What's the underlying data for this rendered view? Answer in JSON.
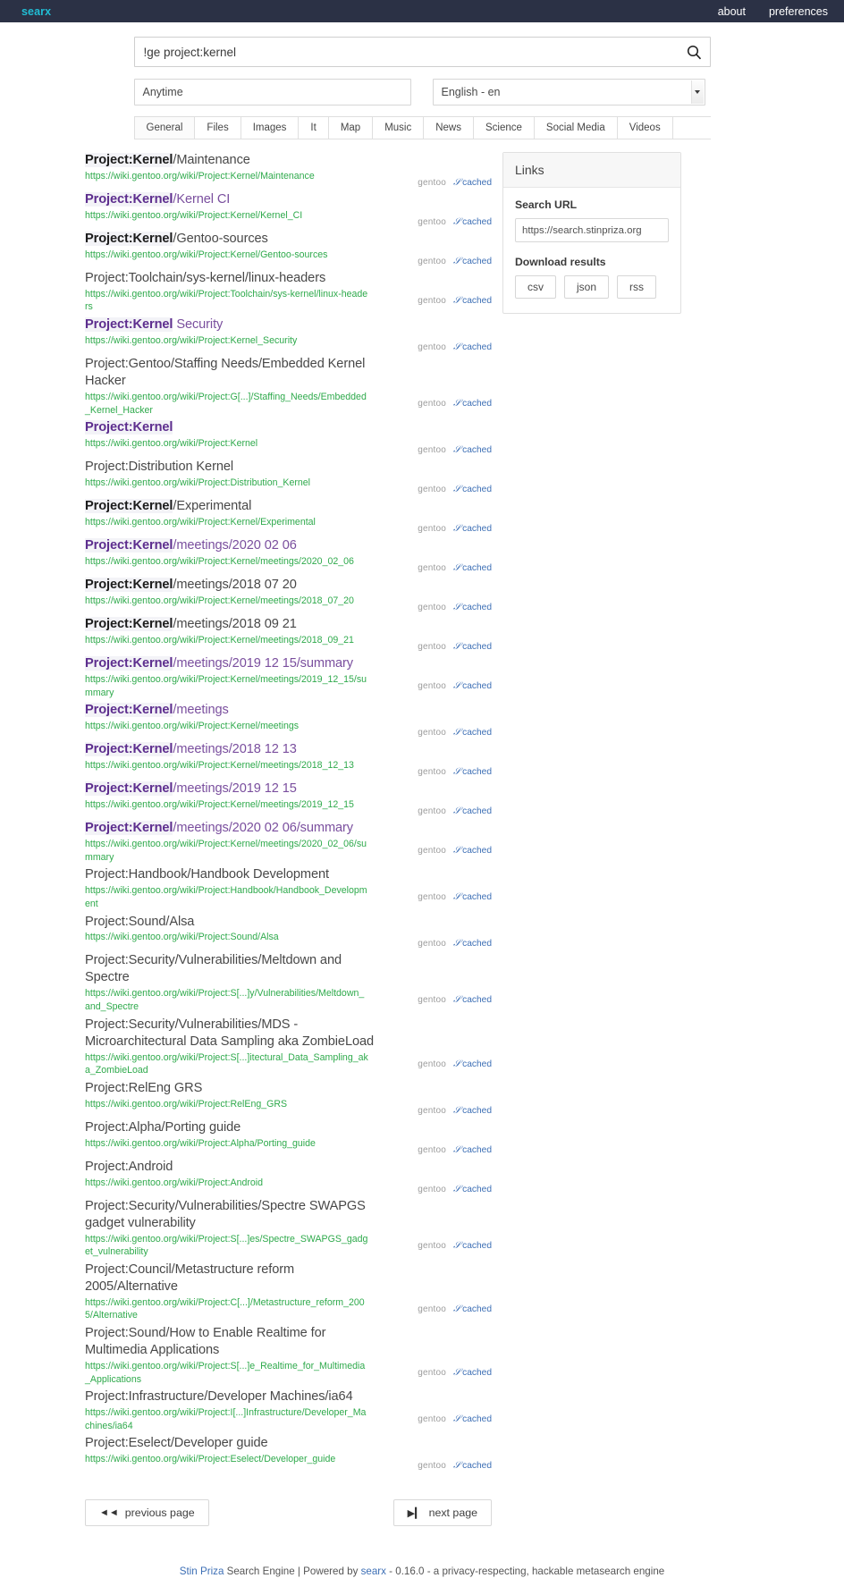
{
  "navbar": {
    "brand": "searx",
    "links": [
      {
        "label": "about"
      },
      {
        "label": "preferences"
      }
    ]
  },
  "search": {
    "query": "!ge project:kernel",
    "placeholder": "",
    "time_range": "Anytime",
    "language": "English - en",
    "search_icon": "search-icon"
  },
  "categories": [
    {
      "label": "General",
      "active": true
    },
    {
      "label": "Files",
      "active": false
    },
    {
      "label": "Images",
      "active": false
    },
    {
      "label": "It",
      "active": false
    },
    {
      "label": "Map",
      "active": false
    },
    {
      "label": "Music",
      "active": false
    },
    {
      "label": "News",
      "active": false
    },
    {
      "label": "Science",
      "active": false
    },
    {
      "label": "Social Media",
      "active": false
    },
    {
      "label": "Videos",
      "active": false
    }
  ],
  "results_meta": {
    "engine_label": "gentoo",
    "cached_label": "cached"
  },
  "results": [
    {
      "title_bold": "Project:Kernel",
      "title_rest": "/Maintenance",
      "visited": false,
      "url": "https://wiki.gentoo.org/wiki/Project:Kernel/Maintenance",
      "engine": "gentoo",
      "cached": "cached"
    },
    {
      "title_bold": "Project:Kernel",
      "title_rest": "/Kernel CI",
      "visited": true,
      "url": "https://wiki.gentoo.org/wiki/Project:Kernel/Kernel_CI",
      "engine": "gentoo",
      "cached": "cached"
    },
    {
      "title_bold": "Project:Kernel",
      "title_rest": "/Gentoo-sources",
      "visited": false,
      "url": "https://wiki.gentoo.org/wiki/Project:Kernel/Gentoo-sources",
      "engine": "gentoo",
      "cached": "cached"
    },
    {
      "title_bold": "",
      "title_rest": "Project:Toolchain/sys-kernel/linux-headers",
      "visited": false,
      "url": "https://wiki.gentoo.org/wiki/Project:Toolchain/sys-kernel/linux-headers",
      "engine": "gentoo",
      "cached": "cached"
    },
    {
      "title_bold": "Project:Kernel",
      "title_rest": " Security",
      "visited": true,
      "url": "https://wiki.gentoo.org/wiki/Project:Kernel_Security",
      "engine": "gentoo",
      "cached": "cached"
    },
    {
      "title_bold": "",
      "title_rest": "Project:Gentoo/Staffing Needs/Embedded Kernel Hacker",
      "visited": false,
      "url": "https://wiki.gentoo.org/wiki/Project:G[...]/Staffing_Needs/Embedded_Kernel_Hacker",
      "engine": "gentoo",
      "cached": "cached"
    },
    {
      "title_bold": "Project:Kernel",
      "title_rest": "",
      "visited": true,
      "url": "https://wiki.gentoo.org/wiki/Project:Kernel",
      "engine": "gentoo",
      "cached": "cached"
    },
    {
      "title_bold": "",
      "title_rest": "Project:Distribution Kernel",
      "visited": false,
      "url": "https://wiki.gentoo.org/wiki/Project:Distribution_Kernel",
      "engine": "gentoo",
      "cached": "cached"
    },
    {
      "title_bold": "Project:Kernel",
      "title_rest": "/Experimental",
      "visited": false,
      "url": "https://wiki.gentoo.org/wiki/Project:Kernel/Experimental",
      "engine": "gentoo",
      "cached": "cached"
    },
    {
      "title_bold": "Project:Kernel",
      "title_rest": "/meetings/2020 02 06",
      "visited": true,
      "url": "https://wiki.gentoo.org/wiki/Project:Kernel/meetings/2020_02_06",
      "engine": "gentoo",
      "cached": "cached"
    },
    {
      "title_bold": "Project:Kernel",
      "title_rest": "/meetings/2018 07 20",
      "visited": false,
      "url": "https://wiki.gentoo.org/wiki/Project:Kernel/meetings/2018_07_20",
      "engine": "gentoo",
      "cached": "cached"
    },
    {
      "title_bold": "Project:Kernel",
      "title_rest": "/meetings/2018 09 21",
      "visited": false,
      "url": "https://wiki.gentoo.org/wiki/Project:Kernel/meetings/2018_09_21",
      "engine": "gentoo",
      "cached": "cached"
    },
    {
      "title_bold": "Project:Kernel",
      "title_rest": "/meetings/2019 12 15/summary",
      "visited": true,
      "url": "https://wiki.gentoo.org/wiki/Project:Kernel/meetings/2019_12_15/summary",
      "engine": "gentoo",
      "cached": "cached"
    },
    {
      "title_bold": "Project:Kernel",
      "title_rest": "/meetings",
      "visited": true,
      "url": "https://wiki.gentoo.org/wiki/Project:Kernel/meetings",
      "engine": "gentoo",
      "cached": "cached"
    },
    {
      "title_bold": "Project:Kernel",
      "title_rest": "/meetings/2018 12 13",
      "visited": true,
      "url": "https://wiki.gentoo.org/wiki/Project:Kernel/meetings/2018_12_13",
      "engine": "gentoo",
      "cached": "cached"
    },
    {
      "title_bold": "Project:Kernel",
      "title_rest": "/meetings/2019 12 15",
      "visited": true,
      "url": "https://wiki.gentoo.org/wiki/Project:Kernel/meetings/2019_12_15",
      "engine": "gentoo",
      "cached": "cached"
    },
    {
      "title_bold": "Project:Kernel",
      "title_rest": "/meetings/2020 02 06/summary",
      "visited": true,
      "url": "https://wiki.gentoo.org/wiki/Project:Kernel/meetings/2020_02_06/summary",
      "engine": "gentoo",
      "cached": "cached"
    },
    {
      "title_bold": "",
      "title_rest": "Project:Handbook/Handbook Development",
      "visited": false,
      "url": "https://wiki.gentoo.org/wiki/Project:Handbook/Handbook_Development",
      "engine": "gentoo",
      "cached": "cached"
    },
    {
      "title_bold": "",
      "title_rest": "Project:Sound/Alsa",
      "visited": false,
      "url": "https://wiki.gentoo.org/wiki/Project:Sound/Alsa",
      "engine": "gentoo",
      "cached": "cached"
    },
    {
      "title_bold": "",
      "title_rest": "Project:Security/Vulnerabilities/Meltdown and Spectre",
      "visited": false,
      "url": "https://wiki.gentoo.org/wiki/Project:S[...]y/Vulnerabilities/Meltdown_and_Spectre",
      "engine": "gentoo",
      "cached": "cached"
    },
    {
      "title_bold": "",
      "title_rest": "Project:Security/Vulnerabilities/MDS - Microarchitectural Data Sampling aka ZombieLoad",
      "visited": false,
      "url": "https://wiki.gentoo.org/wiki/Project:S[...]itectural_Data_Sampling_aka_ZombieLoad",
      "engine": "gentoo",
      "cached": "cached"
    },
    {
      "title_bold": "",
      "title_rest": "Project:RelEng GRS",
      "visited": false,
      "url": "https://wiki.gentoo.org/wiki/Project:RelEng_GRS",
      "engine": "gentoo",
      "cached": "cached"
    },
    {
      "title_bold": "",
      "title_rest": "Project:Alpha/Porting guide",
      "visited": false,
      "url": "https://wiki.gentoo.org/wiki/Project:Alpha/Porting_guide",
      "engine": "gentoo",
      "cached": "cached"
    },
    {
      "title_bold": "",
      "title_rest": "Project:Android",
      "visited": false,
      "url": "https://wiki.gentoo.org/wiki/Project:Android",
      "engine": "gentoo",
      "cached": "cached"
    },
    {
      "title_bold": "",
      "title_rest": "Project:Security/Vulnerabilities/Spectre SWAPGS gadget vulnerability",
      "visited": false,
      "url": "https://wiki.gentoo.org/wiki/Project:S[...]es/Spectre_SWAPGS_gadget_vulnerability",
      "engine": "gentoo",
      "cached": "cached"
    },
    {
      "title_bold": "",
      "title_rest": "Project:Council/Metastructure reform 2005/Alternative",
      "visited": false,
      "url": "https://wiki.gentoo.org/wiki/Project:C[...]/Metastructure_reform_2005/Alternative",
      "engine": "gentoo",
      "cached": "cached"
    },
    {
      "title_bold": "",
      "title_rest": "Project:Sound/How to Enable Realtime for Multimedia Applications",
      "visited": false,
      "url": "https://wiki.gentoo.org/wiki/Project:S[...]e_Realtime_for_Multimedia_Applications",
      "engine": "gentoo",
      "cached": "cached"
    },
    {
      "title_bold": "",
      "title_rest": "Project:Infrastructure/Developer Machines/ia64",
      "visited": false,
      "url": "https://wiki.gentoo.org/wiki/Project:I[...]Infrastructure/Developer_Machines/ia64",
      "engine": "gentoo",
      "cached": "cached"
    },
    {
      "title_bold": "",
      "title_rest": "Project:Eselect/Developer guide",
      "visited": false,
      "url": "https://wiki.gentoo.org/wiki/Project:Eselect/Developer_guide",
      "engine": "gentoo",
      "cached": "cached"
    }
  ],
  "sidebar": {
    "heading": "Links",
    "search_url_label": "Search URL",
    "search_url_value": "https://search.stinpriza.org",
    "download_label": "Download results",
    "download_formats": [
      {
        "label": "csv"
      },
      {
        "label": "json"
      },
      {
        "label": "rss"
      }
    ]
  },
  "pagination": {
    "previous": "previous page",
    "next": "next page",
    "prev_icon": "double-chevron-left-icon",
    "next_icon": "chevron-right-bar-icon"
  },
  "footer": {
    "brand": "Stin Priza",
    "text_1": " Search Engine | Powered by ",
    "engine": "searx",
    "text_2": " - 0.16.0 - a privacy-respecting, hackable metasearch engine"
  }
}
